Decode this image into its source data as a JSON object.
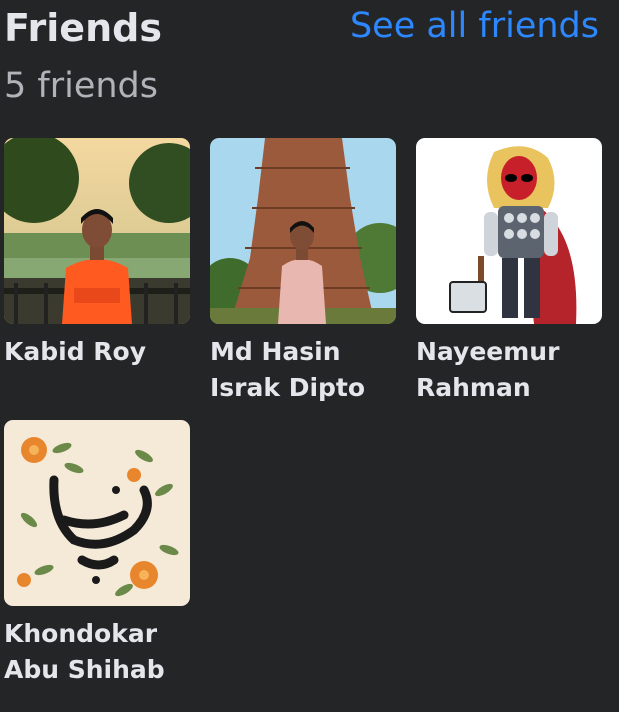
{
  "header": {
    "title": "Friends",
    "see_all_label": "See all friends",
    "count_label": "5 friends"
  },
  "colors": {
    "background": "#242526",
    "link": "#2d88ff",
    "primary_text": "#e4e6eb",
    "secondary_text": "#b0b3b8"
  },
  "friends": [
    {
      "name": "Kabid Roy",
      "photo": "man-in-orange-shirt-by-lake-photo"
    },
    {
      "name": "Md Hasin Israk Dipto",
      "photo": "man-in-front-of-brick-temple-photo"
    },
    {
      "name": "Nayeemur Rahman",
      "photo": "deadpool-thor-cartoon-avatar"
    },
    {
      "name": "Khondokar Abu Shihab",
      "photo": "floral-calligraphy-avatar"
    }
  ]
}
